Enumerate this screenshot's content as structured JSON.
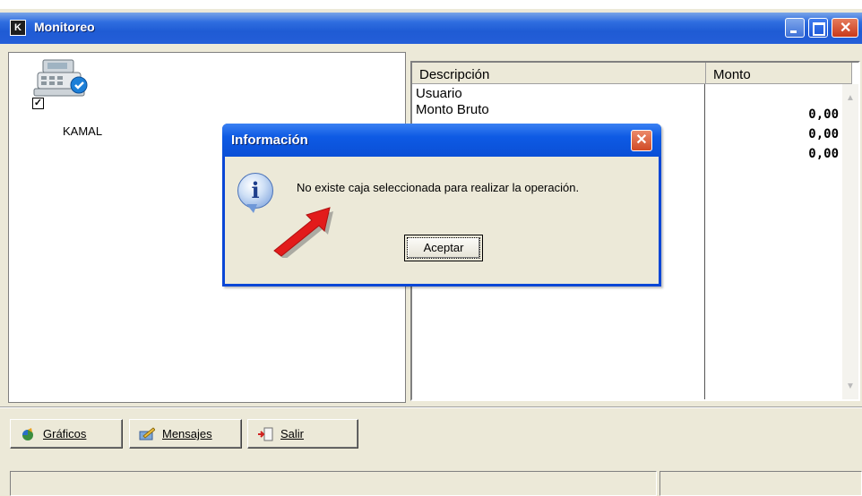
{
  "window": {
    "title": "Monitoreo"
  },
  "terminal": {
    "label": "KAMAL",
    "checked": true,
    "check_mark": "✓"
  },
  "table": {
    "headers": [
      "Descripción",
      "Monto"
    ],
    "rows": [
      {
        "description": "Usuario",
        "amount": ""
      },
      {
        "description": "Monto Bruto",
        "amount": "0,00"
      },
      {
        "description": "",
        "amount": "0,00"
      },
      {
        "description": "",
        "amount": "0,00"
      }
    ]
  },
  "toolbar": {
    "graficos_label": "Gráficos",
    "mensajes_label": "Mensajes",
    "salir_label": "Salir"
  },
  "dialog": {
    "title": "Información",
    "message": "No existe caja seleccionada para realizar la operación.",
    "ok_label": "Aceptar"
  },
  "icons": {
    "app": "app-icon",
    "terminal": "cash-register-icon",
    "graficos": "chart-globe-icon",
    "mensajes": "message-pencil-icon",
    "salir": "exit-door-icon",
    "info": "info-icon"
  },
  "colors": {
    "titlebar": "#245ed8",
    "dialog_border": "#0a47d6",
    "arrow": "#e21b1b"
  }
}
